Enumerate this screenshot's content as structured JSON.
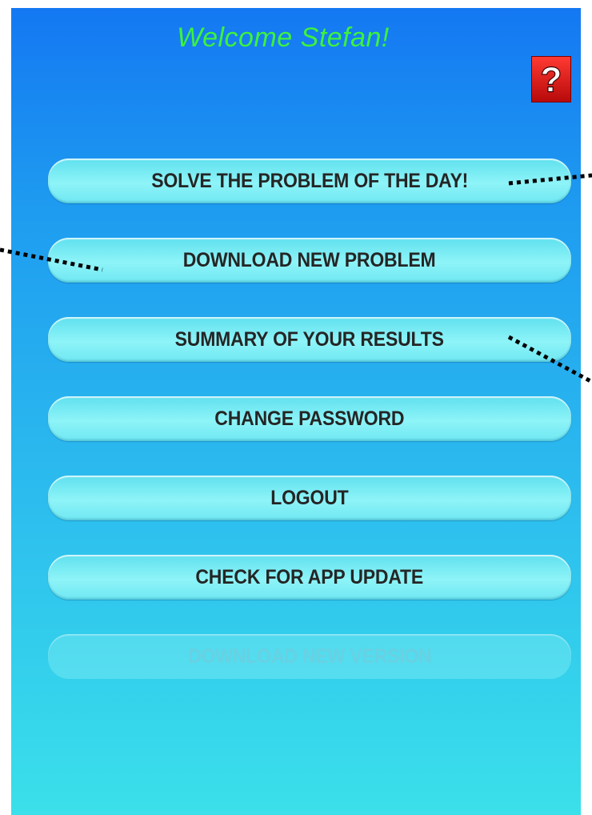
{
  "header": {
    "welcome": "Welcome  Stefan!",
    "help_symbol": "?",
    "help_icon": "question-mark-icon"
  },
  "menu": [
    {
      "label": "SOLVE THE PROBLEM OF THE DAY!",
      "enabled": true
    },
    {
      "label": "DOWNLOAD NEW PROBLEM",
      "enabled": true
    },
    {
      "label": "SUMMARY OF YOUR RESULTS",
      "enabled": true
    },
    {
      "label": "CHANGE PASSWORD",
      "enabled": true
    },
    {
      "label": "LOGOUT",
      "enabled": true
    },
    {
      "label": "CHECK FOR APP UPDATE",
      "enabled": true
    },
    {
      "label": "DOWNLOAD NEW VERSION",
      "enabled": false
    }
  ],
  "colors": {
    "background_top": "#1478f2",
    "background_bottom": "#3ae0ea",
    "welcome_text": "#3df23d",
    "button_face": "#8ef4f8",
    "button_text": "#252525",
    "help_button": "#e8201a"
  }
}
